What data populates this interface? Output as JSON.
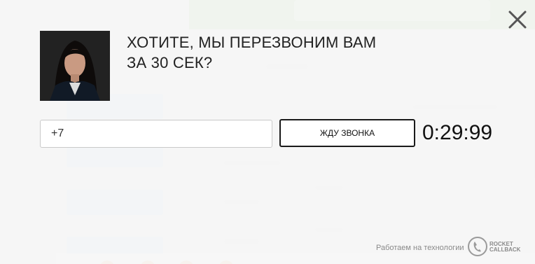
{
  "popup": {
    "title_line1": "ХОТИТЕ, МЫ ПЕРЕЗВОНИМ ВАМ",
    "title_line2": "ЗА 30 СЕК?",
    "phone_value": "+7",
    "call_button_label": "ЖДУ ЗВОНКА",
    "timer": "0:29:99",
    "footer_text": "Работаем на технологии",
    "logo_line1": "ROCKET",
    "logo_line2": "CALLBACK"
  },
  "icons": {
    "close": "close-icon",
    "phone": "phone-icon"
  },
  "colors": {
    "overlay": "#f6f6f6",
    "text": "#222222",
    "button_border": "#1a1a1a",
    "background_green": "#cfe8c9",
    "footer_text": "#8a8a8a"
  }
}
